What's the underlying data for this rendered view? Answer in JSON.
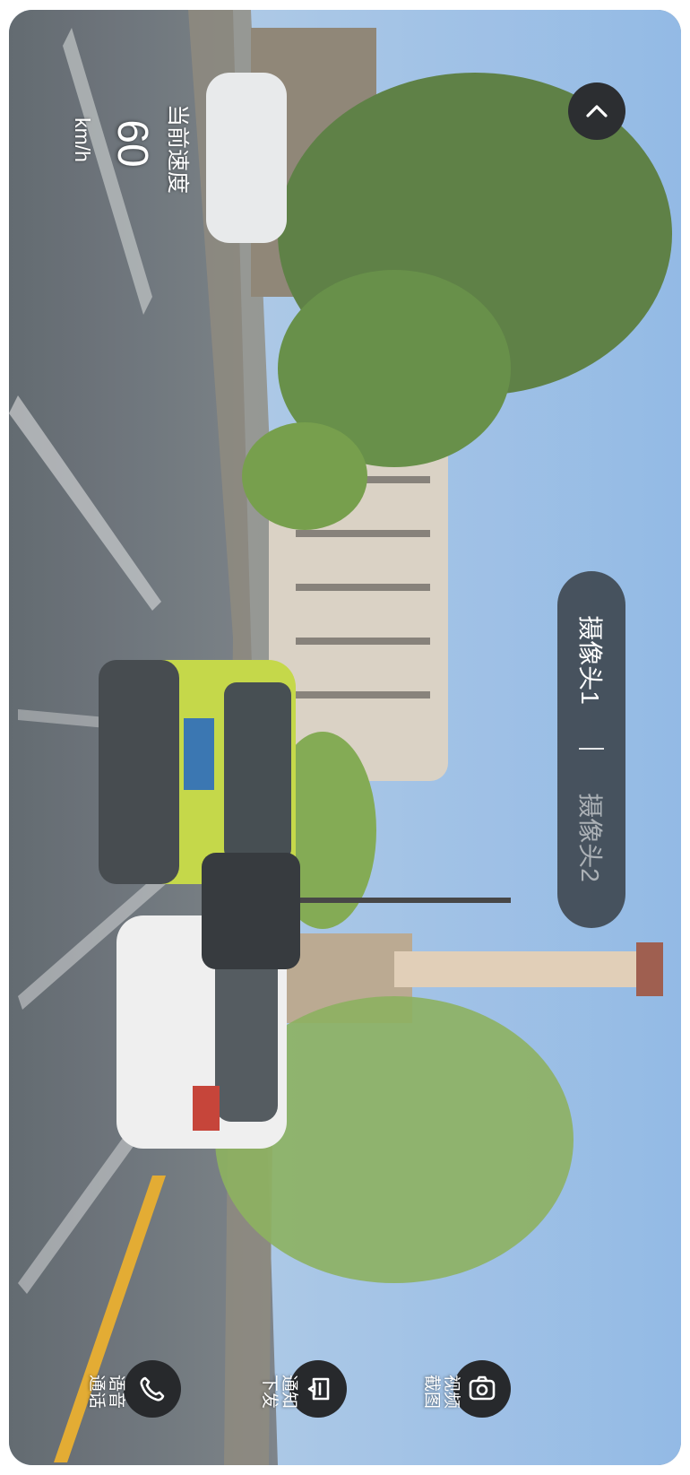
{
  "speed": {
    "title": "当前速度",
    "value": "60",
    "unit": "km/h"
  },
  "camera_switch": {
    "options": [
      {
        "label": "摄像头1",
        "selected": true
      },
      {
        "label": "摄像头2",
        "selected": false
      }
    ]
  },
  "controls": {
    "collapse_icon": "chevron-up-icon"
  },
  "actions": [
    {
      "label": "视频截图",
      "icon": "camera-icon"
    },
    {
      "label": "通知下发",
      "icon": "notify-icon"
    },
    {
      "label": "语音通话",
      "icon": "phone-icon"
    }
  ],
  "colors": {
    "button_bg": "#27292c",
    "switch_bg": "#343a40",
    "text": "#ffffff"
  }
}
